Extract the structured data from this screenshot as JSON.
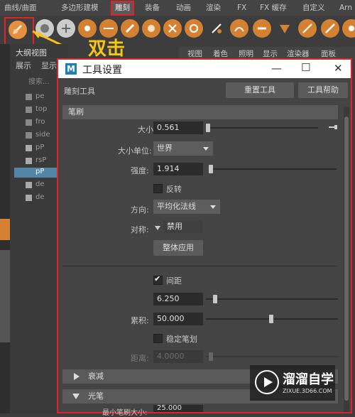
{
  "menubar": {
    "tabs": [
      "曲线/曲面",
      "多边形建模",
      "雕刻",
      "装备",
      "动画",
      "渲染",
      "FX",
      "FX 缓存",
      "自定义",
      "Arn"
    ],
    "active_tab": "雕刻"
  },
  "annotation": {
    "text": "双击",
    "color": "#f5c518"
  },
  "outliner": {
    "title": "大纲视图",
    "menu": [
      "展示",
      "显示"
    ],
    "search_placeholder": "搜索...",
    "items": [
      "pe",
      "top",
      "fro",
      "side",
      "pP",
      "rsP",
      "pP",
      "de",
      "de"
    ]
  },
  "viewport_menu": [
    "视图",
    "着色",
    "照明",
    "显示",
    "渲染器",
    "面板"
  ],
  "window": {
    "logo": "M",
    "title": "工具设置",
    "tool_name": "雕刻工具",
    "reset_button": "重置工具",
    "help_button": "工具帮助",
    "section_brush": "笔刷",
    "size_label": "大小:",
    "size_value": "0.561",
    "size_unit_label": "大小单位:",
    "size_unit_value": "世界",
    "strength_label": "强度:",
    "strength_value": "1.914",
    "reflect_label": "反转",
    "direction_label": "方向:",
    "direction_value": "平均化法线",
    "symmetry_label": "对称:",
    "symmetry_value": "禁用",
    "apply_all_button": "整体应用",
    "spacing_label": "间距",
    "spacing_value": "6.250",
    "buildup_label": "累积:",
    "buildup_value": "50.000",
    "steady_label": "稳定笔划",
    "distance_label": "距离:",
    "distance_value": "4.0000",
    "section_falloff": "衰减",
    "section_stylus": "光笔",
    "partial_label": "最小笔刷大小:",
    "partial_value": "25.000"
  },
  "watermark": {
    "title": "溜溜自学",
    "url": "ZIXUE.3D66.COM"
  },
  "colors": {
    "highlight_red": "#e0232a",
    "tool_orange": "#d48232",
    "maya_blue": "#1e7fb6"
  }
}
